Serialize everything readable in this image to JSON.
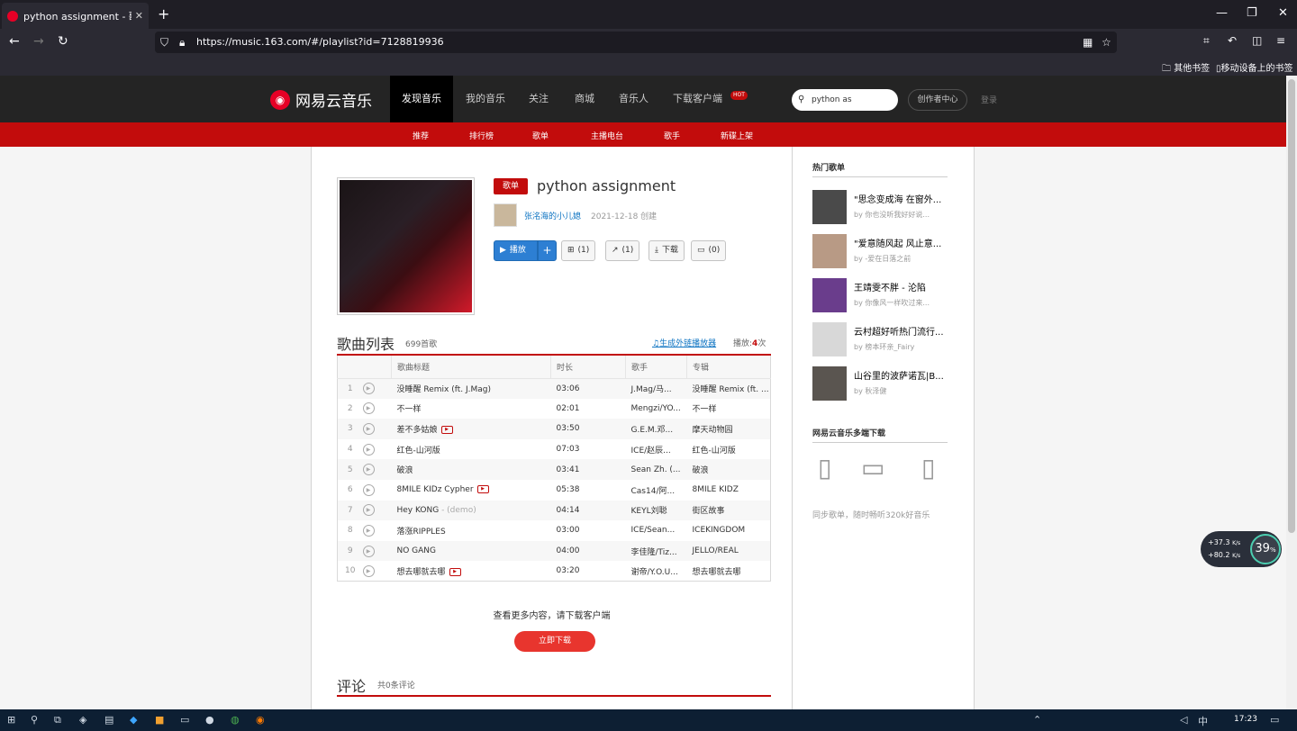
{
  "browser": {
    "tab_title": "python assignment - 歌单 - 网",
    "url": "https://music.163.com/#/playlist?id=7128819936",
    "bookmarks": [
      "其他书签",
      "移动设备上的书签"
    ]
  },
  "topnav": {
    "logo": "网易云音乐",
    "items": [
      "发现音乐",
      "我的音乐",
      "关注",
      "商城",
      "音乐人",
      "下载客户端"
    ],
    "hot_badge": "HOT",
    "search_value": "python as",
    "creator_center": "创作者中心",
    "login": "登录"
  },
  "subnav": {
    "items": [
      "推荐",
      "排行榜",
      "歌单",
      "主播电台",
      "歌手",
      "新碟上架"
    ]
  },
  "playlist": {
    "tag": "歌单",
    "title": "python assignment",
    "creator": "张洺海的小儿媳",
    "created": "2021-12-18 创建",
    "buttons": {
      "play": "播放",
      "collect": "(1)",
      "share": "(1)",
      "download": "下载",
      "comment": "(0)"
    }
  },
  "songlist": {
    "title": "歌曲列表",
    "count": "699首歌",
    "outlink": "生成外链播放器",
    "play_label": "播放:",
    "play_count": "4",
    "play_unit": "次",
    "columns": [
      "歌曲标题",
      "时长",
      "歌手",
      "专辑"
    ],
    "songs": [
      {
        "idx": "1",
        "title": "没睡醒 Remix (ft. J.Mag)",
        "sub": "",
        "mv": false,
        "time": "03:06",
        "artist": "J.Mag/马...",
        "album": "没睡醒 Remix (ft. ..."
      },
      {
        "idx": "2",
        "title": "不一样",
        "sub": "",
        "mv": false,
        "time": "02:01",
        "artist": "Mengzi/YO...",
        "album": "不一样"
      },
      {
        "idx": "3",
        "title": "差不多姑娘",
        "sub": "",
        "mv": true,
        "time": "03:50",
        "artist": "G.E.M.邓...",
        "album": "摩天动物园"
      },
      {
        "idx": "4",
        "title": "红色-山河版",
        "sub": "",
        "mv": false,
        "time": "07:03",
        "artist": "ICE/赵辰...",
        "album": "红色-山河版"
      },
      {
        "idx": "5",
        "title": "破浪",
        "sub": "",
        "mv": false,
        "time": "03:41",
        "artist": "Sean Zh. (...",
        "album": "破浪"
      },
      {
        "idx": "6",
        "title": "8MILE KIDz Cypher",
        "sub": "",
        "mv": true,
        "time": "05:38",
        "artist": "Cas14/阿...",
        "album": "8MILE KIDZ"
      },
      {
        "idx": "7",
        "title": "Hey KONG",
        "sub": " - (demo)",
        "mv": false,
        "time": "04:14",
        "artist": "KEYL刘聪",
        "album": "街区故事"
      },
      {
        "idx": "8",
        "title": "落涨RIPPLES",
        "sub": "",
        "mv": false,
        "time": "03:00",
        "artist": "ICE/Sean...",
        "album": "ICEKINGDOM"
      },
      {
        "idx": "9",
        "title": "NO GANG",
        "sub": "",
        "mv": false,
        "time": "04:00",
        "artist": "李佳隆/Tiz...",
        "album": "JELLO/REAL"
      },
      {
        "idx": "10",
        "title": "想去哪就去哪",
        "sub": "",
        "mv": true,
        "time": "03:20",
        "artist": "谢帝/Y.O.U...",
        "album": "想去哪就去哪"
      }
    ]
  },
  "more_text": "查看更多内容，请下载客户端",
  "download_button": "立即下载",
  "comments": {
    "title": "评论",
    "count": "共0条评论"
  },
  "sidebar": {
    "hot_title": "热门歌单",
    "hot_lists": [
      {
        "title": "\"思念变成海 在窗外...",
        "by": "by 你也没听我好好说..."
      },
      {
        "title": "\"爱意随风起 风止意...",
        "by": "by -爱在日落之前"
      },
      {
        "title": "王靖雯不胖 - 沦陷",
        "by": "by 你像风一样吹过来..."
      },
      {
        "title": "云村超好听热门流行...",
        "by": "by 榜本环亲_Fairy"
      },
      {
        "title": "山谷里的波萨诺瓦|B...",
        "by": "by 秋泽健"
      }
    ],
    "download_title": "网易云音乐多端下载",
    "download_text": "同步歌单，随时畅听320k好音乐"
  },
  "netwidget": {
    "up": "+37.3",
    "down": "+80.2",
    "unit": "K/s",
    "percent": "39"
  },
  "taskbar": {
    "time": "17:23",
    "ime": "中"
  }
}
